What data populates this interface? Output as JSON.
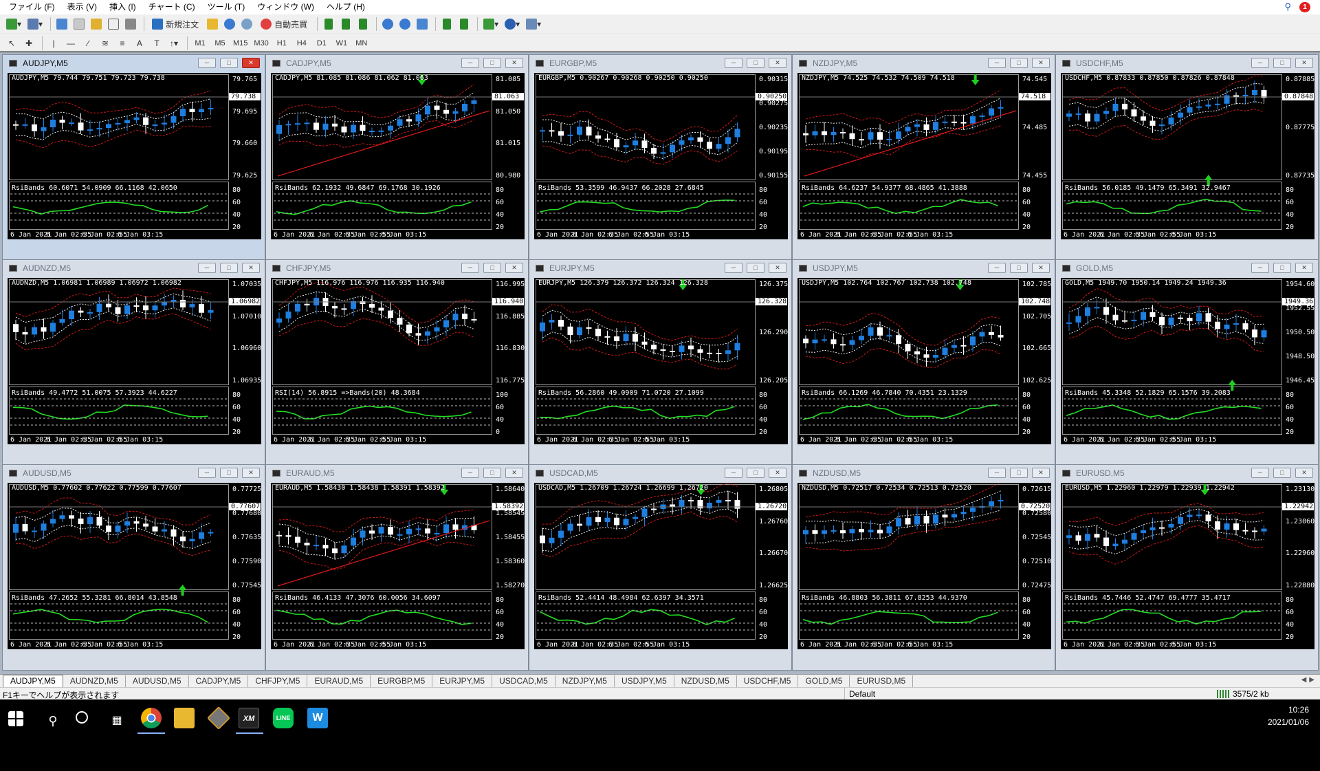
{
  "menu": [
    "ファイル (F)",
    "表示 (V)",
    "挿入 (I)",
    "チャート (C)",
    "ツール (T)",
    "ウィンドウ (W)",
    "ヘルプ (H)"
  ],
  "menu_badge": "1",
  "toolbar": {
    "new_order": "新規注文",
    "auto_trading": "自動売買",
    "timeframes": [
      "M1",
      "M5",
      "M15",
      "M30",
      "H1",
      "H4",
      "D1",
      "W1",
      "MN"
    ]
  },
  "charts": [
    {
      "id": "AUDJPY",
      "title": "AUDJPY,M5",
      "info": "AUDJPY,M5  79.744 79.751 79.723 79.738",
      "rsi": "RsiBands 60.6071 54.0909 66.1168 42.0650",
      "ticks": [
        "79.765",
        "79.695",
        "79.660",
        "79.625"
      ],
      "cur": "79.738",
      "indTicks": [
        "80",
        "60",
        "40",
        "20"
      ],
      "active": true
    },
    {
      "id": "CADJPY",
      "title": "CADJPY,M5",
      "info": "CADJPY,M5  81.085 81.086 81.062 81.063",
      "rsi": "RsiBands 62.1932 49.6847 69.1768 30.1926",
      "ticks": [
        "81.085",
        "81.050",
        "81.015",
        "80.980"
      ],
      "cur": "81.063",
      "indTicks": [
        "80",
        "60",
        "40",
        "20"
      ],
      "active": false
    },
    {
      "id": "EURGBP",
      "title": "EURGBP,M5",
      "info": "EURGBP,M5  0.90267 0.90268 0.90250 0.90250",
      "rsi": "RsiBands 53.3599 46.9437 66.2028 27.6845",
      "ticks": [
        "0.90315",
        "0.90275",
        "0.90235",
        "0.90195",
        "0.90155"
      ],
      "cur": "0.90250",
      "indTicks": [
        "80",
        "60",
        "40",
        "20"
      ],
      "active": false
    },
    {
      "id": "NZDJPY",
      "title": "NZDJPY,M5",
      "info": "NZDJPY,M5  74.525 74.532 74.509 74.518",
      "rsi": "RsiBands 64.6237 54.9377 68.4865 41.3888",
      "ticks": [
        "74.545",
        "74.485",
        "74.455"
      ],
      "cur": "74.518",
      "indTicks": [
        "80",
        "60",
        "40",
        "20"
      ],
      "active": false
    },
    {
      "id": "USDCHF",
      "title": "USDCHF,M5",
      "info": "USDCHF,M5  0.87833 0.87850 0.87826 0.87848",
      "rsi": "RsiBands 56.0185 49.1479 65.3491 32.9467",
      "ticks": [
        "0.87885",
        "0.87775",
        "0.87735"
      ],
      "cur": "0.87848",
      "indTicks": [
        "80",
        "60",
        "40",
        "20"
      ],
      "active": false
    },
    {
      "id": "AUDNZD",
      "title": "AUDNZD,M5",
      "info": "AUDNZD,M5  1.06981 1.06989 1.06972 1.06982",
      "rsi": "RsiBands 49.4772 51.0075 57.3923 44.6227",
      "ticks": [
        "1.07035",
        "1.07010",
        "1.06960",
        "1.06935"
      ],
      "cur": "1.06982",
      "indTicks": [
        "80",
        "60",
        "40",
        "20"
      ],
      "active": false
    },
    {
      "id": "CHFJPY",
      "title": "CHFJPY,M5",
      "info": "CHFJPY,M5  116.976 116.976 116.935 116.940",
      "rsi": "RSI(14) 56.8915  =>Bands(20) 48.3684",
      "ticks": [
        "116.995",
        "116.885",
        "116.830",
        "116.775"
      ],
      "cur": "116.940",
      "indTicks": [
        "100",
        "60",
        "40",
        "0"
      ],
      "active": false
    },
    {
      "id": "EURJPY",
      "title": "EURJPY,M5",
      "info": "EURJPY,M5  126.379 126.372 126.324 126.328",
      "rsi": "RsiBands 56.2860 49.0909 71.0720 27.1099",
      "ticks": [
        "126.375",
        "126.290",
        "126.205"
      ],
      "cur": "126.328",
      "indTicks": [
        "80",
        "60",
        "40",
        "20"
      ],
      "active": false
    },
    {
      "id": "USDJPY",
      "title": "USDJPY,M5",
      "info": "USDJPY,M5  102.764 102.767 102.738 102.748",
      "rsi": "RsiBands 66.1269 46.7840 70.4351 23.1329",
      "ticks": [
        "102.785",
        "102.705",
        "102.665",
        "102.625"
      ],
      "cur": "102.748",
      "indTicks": [
        "80",
        "60",
        "40",
        "20"
      ],
      "active": false
    },
    {
      "id": "GOLD",
      "title": "GOLD,M5",
      "info": "GOLD,M5  1949.70 1950.14 1949.24 1949.36",
      "rsi": "RsiBands 45.3348 52.1829 65.1576 39.2083",
      "ticks": [
        "1954.60",
        "1952.55",
        "1950.50",
        "1948.50",
        "1946.45"
      ],
      "cur": "1949.36",
      "indTicks": [
        "80",
        "60",
        "40",
        "20"
      ],
      "active": false
    },
    {
      "id": "AUDUSD",
      "title": "AUDUSD,M5",
      "info": "AUDUSD,M5  0.77602 0.77622 0.77599 0.77607",
      "rsi": "RsiBands 47.2652 55.3281 66.8014 43.8548",
      "ticks": [
        "0.77725",
        "0.77680",
        "0.77635",
        "0.77590",
        "0.77545"
      ],
      "cur": "0.77607",
      "indTicks": [
        "80",
        "60",
        "40",
        "20"
      ],
      "active": false
    },
    {
      "id": "EURAUD",
      "title": "EURAUD,M5",
      "info": "EURAUD,M5  1.58430 1.58438 1.58391 1.58392",
      "rsi": "RsiBands 46.4133 47.3076 60.0056 34.6097",
      "ticks": [
        "1.58640",
        "1.58545",
        "1.58455",
        "1.58360",
        "1.58270"
      ],
      "cur": "1.58392",
      "indTicks": [
        "80",
        "60",
        "40",
        "20"
      ],
      "active": false
    },
    {
      "id": "USDCAD",
      "title": "USDCAD,M5",
      "info": "USDCAD,M5  1.26709 1.26724 1.26699 1.26720",
      "rsi": "RsiBands 52.4414 48.4984 62.6397 34.3571",
      "ticks": [
        "1.26805",
        "1.26760",
        "1.26670",
        "1.26625"
      ],
      "cur": "1.26720",
      "indTicks": [
        "80",
        "60",
        "40",
        "20"
      ],
      "active": false
    },
    {
      "id": "NZDUSD",
      "title": "NZDUSD,M5",
      "info": "NZDUSD,M5  0.72517 0.72534 0.72513 0.72520",
      "rsi": "RsiBands 46.8803 56.3811 67.8253 44.9370",
      "ticks": [
        "0.72615",
        "0.72580",
        "0.72545",
        "0.72510",
        "0.72475"
      ],
      "cur": "0.72520",
      "indTicks": [
        "80",
        "60",
        "40",
        "20"
      ],
      "active": false
    },
    {
      "id": "EURUSD",
      "title": "EURUSD,M5",
      "info": "EURUSD,M5  1.22960 1.22979 1.22939 1.22942",
      "rsi": "RsiBands 45.7446 52.4747 69.4777 35.4717",
      "ticks": [
        "1.23130",
        "1.23060",
        "1.22960",
        "1.22880"
      ],
      "cur": "1.22942",
      "indTicks": [
        "80",
        "60",
        "40",
        "20"
      ],
      "active": false
    }
  ],
  "time_axis": [
    "6 Jan 2021",
    "6 Jan 02:35",
    "6 Jan 02:55",
    "6 Jan 03:15"
  ],
  "tabs": [
    "AUDJPY,M5",
    "AUDNZD,M5",
    "AUDUSD,M5",
    "CADJPY,M5",
    "CHFJPY,M5",
    "EURAUD,M5",
    "EURGBP,M5",
    "EURJPY,M5",
    "USDCAD,M5",
    "NZDJPY,M5",
    "USDJPY,M5",
    "NZDUSD,M5",
    "USDCHF,M5",
    "GOLD,M5",
    "EURUSD,M5"
  ],
  "status": {
    "help": "F1キーでヘルプが表示されます",
    "profile": "Default",
    "conn": "3575/2 kb"
  },
  "taskbar": {
    "time": "10:26",
    "date": "2021/01/06",
    "xm": "XM",
    "line": "LINE",
    "w": "W"
  },
  "colors": {
    "bull": "#1e7fe0",
    "bear": "#ffffff",
    "rsi": "#22dd22",
    "band": "#d01818",
    "tl": "#e01a1a",
    "arrow": "#22cc22"
  }
}
